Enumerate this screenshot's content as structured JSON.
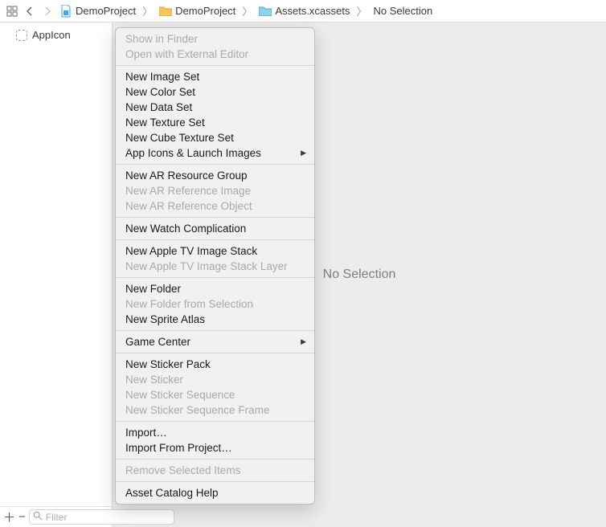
{
  "breadcrumb": {
    "proj": "DemoProject",
    "folder": "DemoProject",
    "assets": "Assets.xcassets",
    "sel": "No Selection"
  },
  "sidebar": {
    "items": [
      {
        "label": "AppIcon"
      }
    ],
    "footer": {
      "filter_placeholder": "Filter"
    }
  },
  "content": {
    "empty": "No Selection"
  },
  "context_menu": {
    "groups": [
      [
        {
          "label": "Show in Finder",
          "enabled": false
        },
        {
          "label": "Open with External Editor",
          "enabled": false
        }
      ],
      [
        {
          "label": "New Image Set",
          "enabled": true
        },
        {
          "label": "New Color Set",
          "enabled": true
        },
        {
          "label": "New Data Set",
          "enabled": true
        },
        {
          "label": "New Texture Set",
          "enabled": true
        },
        {
          "label": "New Cube Texture Set",
          "enabled": true
        },
        {
          "label": "App Icons & Launch Images",
          "enabled": true,
          "submenu": true
        }
      ],
      [
        {
          "label": "New AR Resource Group",
          "enabled": true
        },
        {
          "label": "New AR Reference Image",
          "enabled": false
        },
        {
          "label": "New AR Reference Object",
          "enabled": false
        }
      ],
      [
        {
          "label": "New Watch Complication",
          "enabled": true
        }
      ],
      [
        {
          "label": "New Apple TV Image Stack",
          "enabled": true
        },
        {
          "label": "New Apple TV Image Stack Layer",
          "enabled": false
        }
      ],
      [
        {
          "label": "New Folder",
          "enabled": true
        },
        {
          "label": "New Folder from Selection",
          "enabled": false
        },
        {
          "label": "New Sprite Atlas",
          "enabled": true
        }
      ],
      [
        {
          "label": "Game Center",
          "enabled": true,
          "submenu": true
        }
      ],
      [
        {
          "label": "New Sticker Pack",
          "enabled": true
        },
        {
          "label": "New Sticker",
          "enabled": false
        },
        {
          "label": "New Sticker Sequence",
          "enabled": false
        },
        {
          "label": "New Sticker Sequence Frame",
          "enabled": false
        }
      ],
      [
        {
          "label": "Import…",
          "enabled": true
        },
        {
          "label": "Import From Project…",
          "enabled": true
        }
      ],
      [
        {
          "label": "Remove Selected Items",
          "enabled": false
        }
      ],
      [
        {
          "label": "Asset Catalog Help",
          "enabled": true
        }
      ]
    ]
  }
}
